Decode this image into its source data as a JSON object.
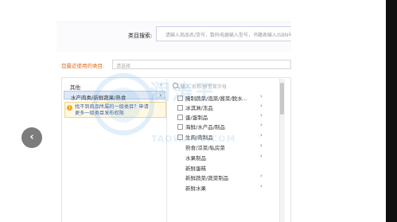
{
  "category_search": {
    "label": "类目搜索:",
    "placeholder": "请输入商品名/货号，数码电器输入型号，书籍表输入ISBN号"
  },
  "recent": {
    "label": "您最近使用的类目:",
    "select_placeholder": "请选择"
  },
  "level1": {
    "items": [
      {
        "label": "其他",
        "selected": false
      },
      {
        "label": "水产肉类/新鲜蔬果/熟食",
        "selected": true
      }
    ],
    "hint": {
      "icon": "warning-icon",
      "line1": "找不到商品所属的一级类目？申请",
      "line2": "更多一级类目发布权限"
    }
  },
  "level2": {
    "search_placeholder": "输入 名称/拼音首字母",
    "items": [
      "腌制蔬菜/泡菜/酱菜/脱水...",
      "冰淇淋/冻品",
      "蛋/蛋制品",
      "海鲜/水产品/制品",
      "生肉/肉制品",
      "熟食/凉菜/私房菜",
      "水果制品",
      "新鲜蛋糕",
      "新鲜蔬菜/蔬菜制品",
      "新鲜水果"
    ]
  },
  "watermark": {
    "main": "润涛王",
    "sub": "TAOWANG.COM"
  },
  "icons": {
    "prev": "chevron-left-icon",
    "search": "search-icon",
    "arrow": "chevron-right-icon"
  },
  "colors": {
    "accent_orange": "#e06a1a",
    "selected_bg": "#dfe8f6",
    "hint_link": "#3a5db0"
  }
}
